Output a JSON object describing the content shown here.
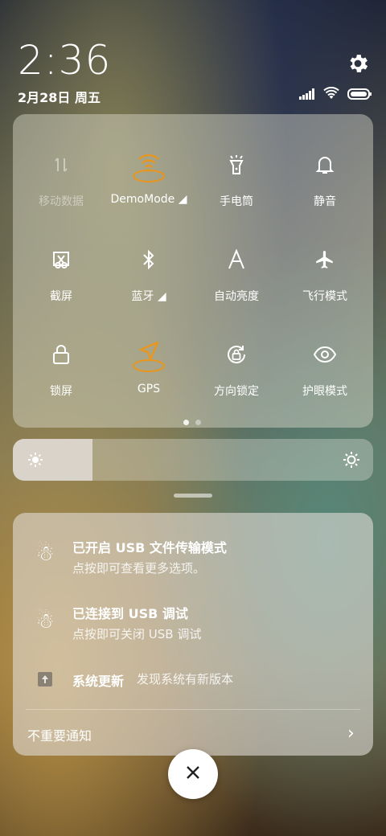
{
  "status": {
    "time": "2:36",
    "date": "2月28日 周五",
    "icons": [
      "signal-icon",
      "wifi-icon",
      "battery-icon"
    ]
  },
  "quick_settings": {
    "accent": "#e8961e",
    "tiles": [
      {
        "label": "移动数据",
        "icon": "mobile-data-icon",
        "active": false,
        "disabled": true
      },
      {
        "label": "DemoMode ◢",
        "icon": "wifi-hotspot-icon",
        "active": true,
        "disabled": false
      },
      {
        "label": "手电筒",
        "icon": "flashlight-icon",
        "active": false,
        "disabled": false
      },
      {
        "label": "静音",
        "icon": "bell-icon",
        "active": false,
        "disabled": false
      },
      {
        "label": "截屏",
        "icon": "screenshot-icon",
        "active": false,
        "disabled": false
      },
      {
        "label": "蓝牙 ◢",
        "icon": "bluetooth-icon",
        "active": false,
        "disabled": false
      },
      {
        "label": "自动亮度",
        "icon": "auto-brightness-icon",
        "active": false,
        "disabled": false
      },
      {
        "label": "飞行模式",
        "icon": "airplane-icon",
        "active": false,
        "disabled": false
      },
      {
        "label": "锁屏",
        "icon": "lock-icon",
        "active": false,
        "disabled": false
      },
      {
        "label": "GPS",
        "icon": "gps-icon",
        "active": true,
        "disabled": false
      },
      {
        "label": "方向锁定",
        "icon": "rotation-lock-icon",
        "active": false,
        "disabled": false
      },
      {
        "label": "护眼模式",
        "icon": "eye-icon",
        "active": false,
        "disabled": false
      }
    ],
    "page_indicator": {
      "pages": 2,
      "current": 1
    }
  },
  "brightness": {
    "level_percent": 22
  },
  "notifications": [
    {
      "icon": "snowman-icon",
      "title": "已开启 USB 文件传输模式",
      "subtitle": "点按即可查看更多选项。"
    },
    {
      "icon": "snowman-icon",
      "title": "已连接到 USB 调试",
      "subtitle": "点按即可关闭 USB 调试"
    },
    {
      "icon": "system-update-icon",
      "title": "系统更新",
      "subtitle": "发现系统有新版本"
    }
  ],
  "unimportant_label": "不重要通知"
}
